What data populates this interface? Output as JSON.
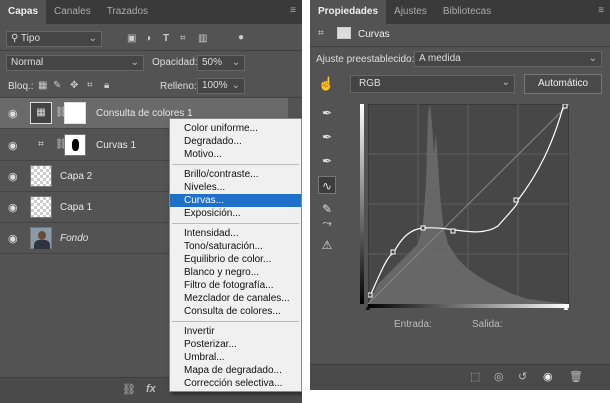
{
  "layers_panel": {
    "tabs": [
      "Capas",
      "Canales",
      "Trazados"
    ],
    "filter_label": "Tipo",
    "blend_mode": "Normal",
    "opacity_label": "Opacidad:",
    "opacity_value": "50%",
    "lock_label": "Bloq.:",
    "fill_label": "Relleno:",
    "fill_value": "100%",
    "layers": [
      {
        "name": "Consulta de colores 1",
        "selected": true
      },
      {
        "name": "Curvas 1",
        "selected": false
      },
      {
        "name": "Capa 2",
        "selected": false
      },
      {
        "name": "Capa 1",
        "selected": false
      },
      {
        "name": "Fondo",
        "selected": false
      }
    ]
  },
  "context_menu": {
    "group1": [
      "Color uniforme...",
      "Degradado...",
      "Motivo..."
    ],
    "group2": [
      "Brillo/contraste...",
      "Niveles...",
      "Curvas...",
      "Exposición..."
    ],
    "group3": [
      "Intensidad...",
      "Tono/saturación...",
      "Equilibrio de color...",
      "Blanco y negro...",
      "Filtro de fotografía...",
      "Mezclador de canales...",
      "Consulta de colores..."
    ],
    "group4": [
      "Invertir",
      "Posterizar...",
      "Umbral...",
      "Mapa de degradado...",
      "Corrección selectiva..."
    ],
    "highlighted": "Curvas..."
  },
  "properties_panel": {
    "tabs": [
      "Propiedades",
      "Ajustes",
      "Bibliotecas"
    ],
    "title": "Curvas",
    "preset_label": "Ajuste preestablecido:",
    "preset_value": "A medida",
    "channel_value": "RGB",
    "auto_button": "Automático",
    "input_label": "Entrada:",
    "output_label": "Salida:"
  }
}
